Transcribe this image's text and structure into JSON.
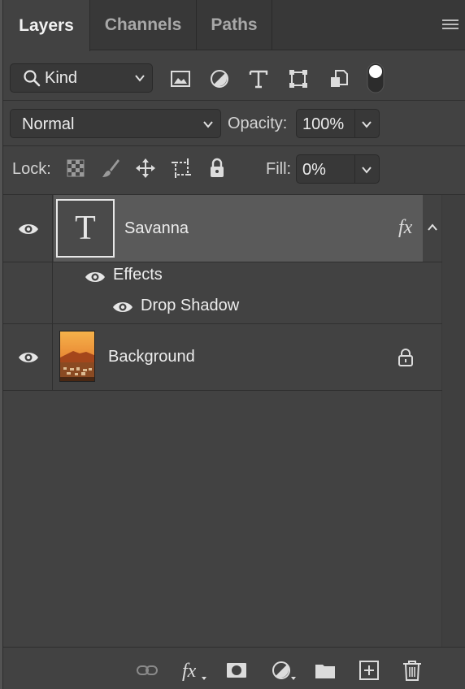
{
  "tabs": [
    {
      "label": "Layers",
      "active": true
    },
    {
      "label": "Channels",
      "active": false
    },
    {
      "label": "Paths",
      "active": false
    }
  ],
  "filter": {
    "kind_label": "Kind",
    "icons": [
      "image-filter-icon",
      "adjustment-filter-icon",
      "type-filter-icon",
      "shape-filter-icon",
      "smart-object-filter-icon",
      "filter-toggle-icon"
    ]
  },
  "blend": {
    "mode": "Normal",
    "opacity_label": "Opacity:",
    "opacity_value": "100%"
  },
  "lock": {
    "label": "Lock:",
    "fill_label": "Fill:",
    "fill_value": "0%",
    "icons": [
      "lock-transparent-pixels-icon",
      "lock-image-pixels-icon",
      "lock-position-icon",
      "lock-artboard-icon",
      "lock-all-icon"
    ]
  },
  "layers": [
    {
      "name": "Savanna",
      "type": "text",
      "selected": true,
      "visible": true,
      "fx": "fx",
      "thumb_glyph": "T"
    },
    {
      "effects_label": "Effects",
      "effect_name": "Drop Shadow"
    },
    {
      "name": "Background",
      "type": "image",
      "selected": false,
      "visible": true,
      "locked": true
    }
  ],
  "bottom_icons": [
    "link-layers-icon",
    "add-layer-style-icon",
    "add-mask-icon",
    "new-adjustment-layer-icon",
    "new-group-icon",
    "new-layer-icon",
    "delete-layer-icon"
  ],
  "colors": {
    "panel_bg": "#424242",
    "selected_row": "#5a5a5a",
    "tab_bg": "#383838"
  }
}
